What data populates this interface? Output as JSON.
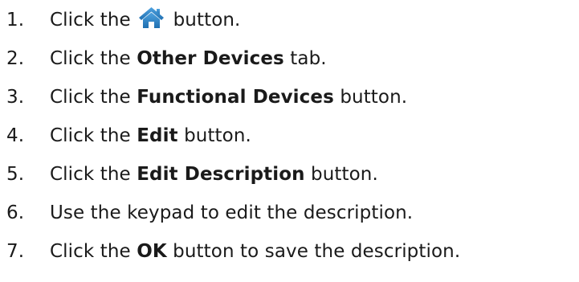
{
  "steps": [
    {
      "num": "1.",
      "pre": "Click the ",
      "post": " button.",
      "icon": "home-icon",
      "icon_color": "#2a7fc1"
    },
    {
      "num": "2.",
      "pre": "Click the ",
      "bold": "Other Devices",
      "post": " tab."
    },
    {
      "num": "3.",
      "pre": "Click the ",
      "bold": "Functional Devices",
      "post": " button."
    },
    {
      "num": "4.",
      "pre": "Click the ",
      "bold": "Edit",
      "post": " button."
    },
    {
      "num": "5.",
      "pre": "Click the ",
      "bold": "Edit Description",
      "post": " button."
    },
    {
      "num": "6.",
      "pre": "Use the keypad to edit the description."
    },
    {
      "num": "7.",
      "pre": "Click the ",
      "bold": "OK",
      "post": " button to save the description."
    }
  ]
}
